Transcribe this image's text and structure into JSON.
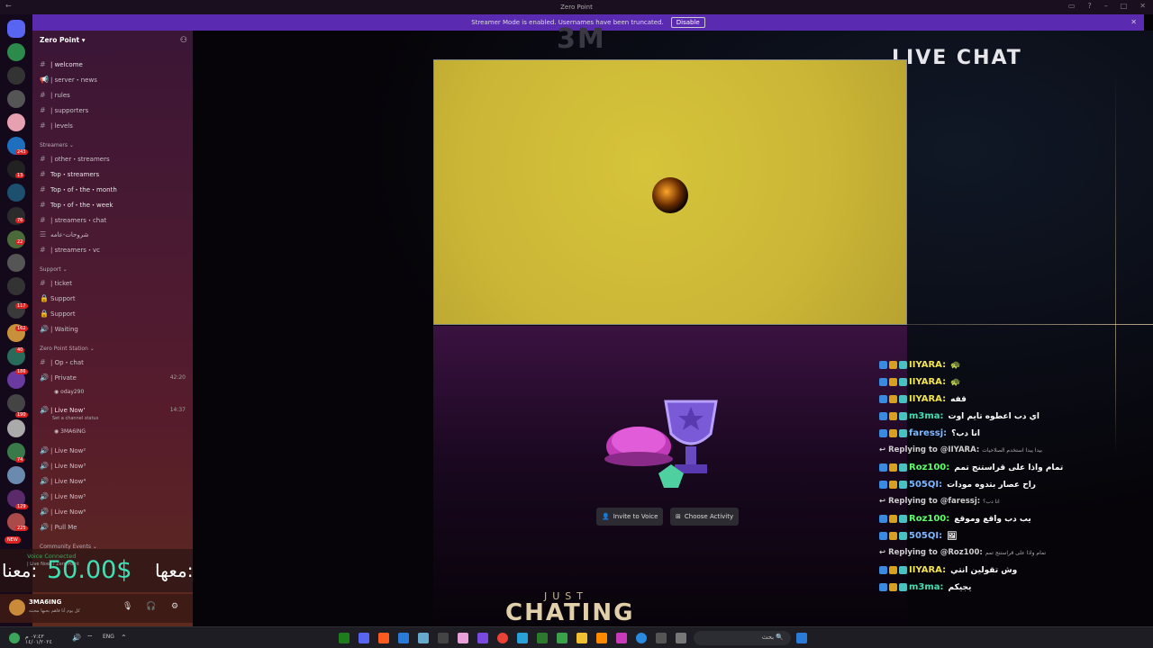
{
  "window": {
    "title": "Zero Point"
  },
  "banner": {
    "text": "Streamer Mode is enabled. Usernames have been truncated.",
    "disable_label": "Disable"
  },
  "rail_badges": [
    "243",
    "13",
    "76",
    "22",
    "117",
    "162",
    "40",
    "186",
    "190",
    "74",
    "129",
    "225"
  ],
  "rail_new": "NEW",
  "server": {
    "name": "Zero Point"
  },
  "channels": {
    "welcome": "| welcome",
    "server_news": "| server・news",
    "rules": "| rules",
    "supporters": "| supporters",
    "levels": "| levels",
    "cat_streamers": "Streamers",
    "other_streamers": "| other・streamers",
    "top_streamers": "Top・streamers",
    "top_month": "Top・of・the・month",
    "top_week": "Top・of・the・week",
    "streamers_chat": "| streamers・chat",
    "arabic_channel": "شروحات-عامه",
    "streamers_vc": "| streamers・vc",
    "cat_support": "Support",
    "ticket": "| ticket",
    "support1": "Support",
    "support2": "Support",
    "waiting": "| Waiting",
    "cat_station": "Zero Point Station",
    "op_chat": "| Op・chat",
    "private": "| Private",
    "private_time": "42:20",
    "private_user": "oday290",
    "live_now": "| Live Now'",
    "live_now_time": "14:37",
    "live_now_status": "Set a channel status",
    "live_now_user": "3MA6ING",
    "live_now2": "| Live Now²",
    "live_now3": "| Live Now³",
    "live_now4": "| Live Now⁴",
    "live_now5": "| Live Now⁵",
    "live_now6": "| Live Now⁶",
    "pull_me": "| Pull Me",
    "cat_events": "Community Events"
  },
  "voice": {
    "connected": "Voice Connected",
    "channel": "| Live Now' / Zero Point"
  },
  "donation": {
    "amount": "50.00$",
    "label": "معنا:",
    "label2": "معها:"
  },
  "user": {
    "name": "3MA6ING",
    "status": "كل يوم أنا فاهم بحبها محبته"
  },
  "stream": {
    "logo": "3M",
    "live_chat_title": "LIVE CHAT",
    "invite_label": "Invite to Voice",
    "activity_label": "Choose Activity",
    "just": "JUST",
    "chating": "CHATING"
  },
  "chat": [
    {
      "type": "msg",
      "user": "IIYARA:",
      "text": "🐢",
      "color": "#f2e34a"
    },
    {
      "type": "msg",
      "user": "IIYARA:",
      "text": "🐢",
      "color": "#f2e34a"
    },
    {
      "type": "msg",
      "user": "IIYARA:",
      "text": "قفه",
      "color": "#f2e34a"
    },
    {
      "type": "msg",
      "user": "m3ma:",
      "text": "اي دب اعطوه تايم اوت",
      "color": "#3fe0b4"
    },
    {
      "type": "msg",
      "user": "faressj:",
      "text": "انا دب؟",
      "color": "#7fb8ff"
    },
    {
      "type": "reply",
      "user": "Replying to @IIYARA:",
      "text": "بيدا يبدا استخدم الصلاحيات"
    },
    {
      "type": "msg",
      "user": "Roz100:",
      "text": "تمام واذا على قراستنج تمم",
      "color": "#5bff6a"
    },
    {
      "type": "msg",
      "user": "505QI:",
      "text": "راح عصار بتدوه مودات",
      "color": "#7fb8ff"
    },
    {
      "type": "reply",
      "user": "Replying to @faressj:",
      "text": "انا دب؟"
    },
    {
      "type": "msg",
      "user": "Roz100:",
      "text": "يب دب واقع وموقع",
      "color": "#5bff6a"
    },
    {
      "type": "msg",
      "user": "505QI:",
      "text": "🖼",
      "color": "#7fb8ff"
    },
    {
      "type": "reply",
      "user": "Replying to @Roz100:",
      "text": "تمام واذا على قراستنج تمم"
    },
    {
      "type": "msg",
      "user": "IIYARA:",
      "text": "وش تقولين انتي",
      "color": "#f2e34a"
    },
    {
      "type": "msg",
      "user": "m3ma:",
      "text": "يجيكم",
      "color": "#3fe0b4"
    }
  ],
  "taskbar": {
    "lang": "ENG",
    "time": "٠٧:٤٣ م",
    "date": "١٤/٠١/٢٠٢٤",
    "search_placeholder": "بحث"
  }
}
